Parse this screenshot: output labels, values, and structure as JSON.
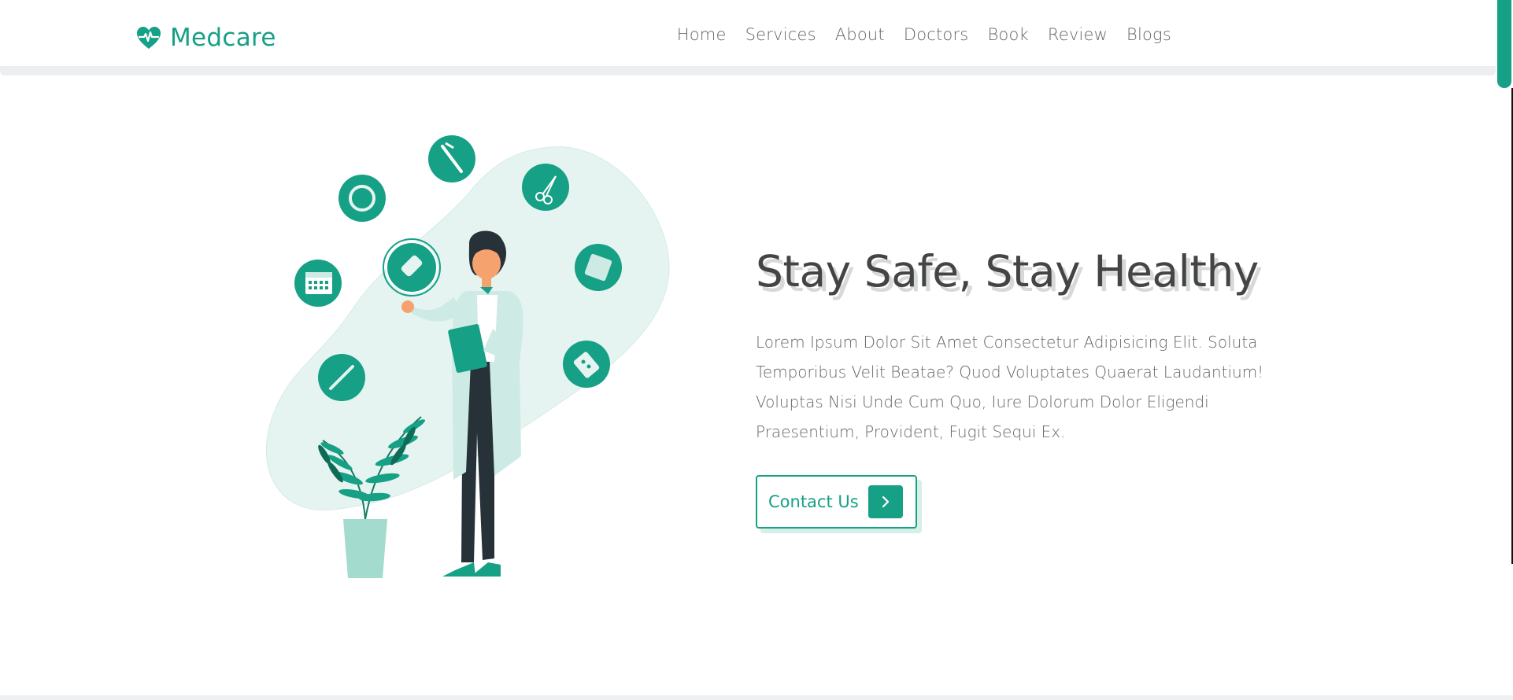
{
  "brand": {
    "name": "Medcare",
    "icon": "heartbeat-icon",
    "color": "#16a085"
  },
  "nav": {
    "items": [
      {
        "label": "Home",
        "name": "nav-home"
      },
      {
        "label": "Services",
        "name": "nav-services"
      },
      {
        "label": "About",
        "name": "nav-about"
      },
      {
        "label": "Doctors",
        "name": "nav-doctors"
      },
      {
        "label": "Book",
        "name": "nav-book"
      },
      {
        "label": "Review",
        "name": "nav-review"
      },
      {
        "label": "Blogs",
        "name": "nav-blogs"
      }
    ]
  },
  "hero": {
    "title": "Stay Safe, Stay Healthy",
    "text": "Lorem Ipsum Dolor Sit Amet Consectetur Adipisicing Elit. Soluta Temporibus Velit Beatae? Quod Voluptates Quaerat Laudantium! Voluptas Nisi Unde Cum Quo, Iure Dolorum Dolor Eligendi Praesentium, Provident, Fugit Sequi Ex.",
    "button_label": "Contact Us",
    "button_icon": "chevron-right-icon"
  },
  "colors": {
    "accent": "#16a085",
    "accent_light": "#e6f4f1",
    "text": "#444444"
  }
}
